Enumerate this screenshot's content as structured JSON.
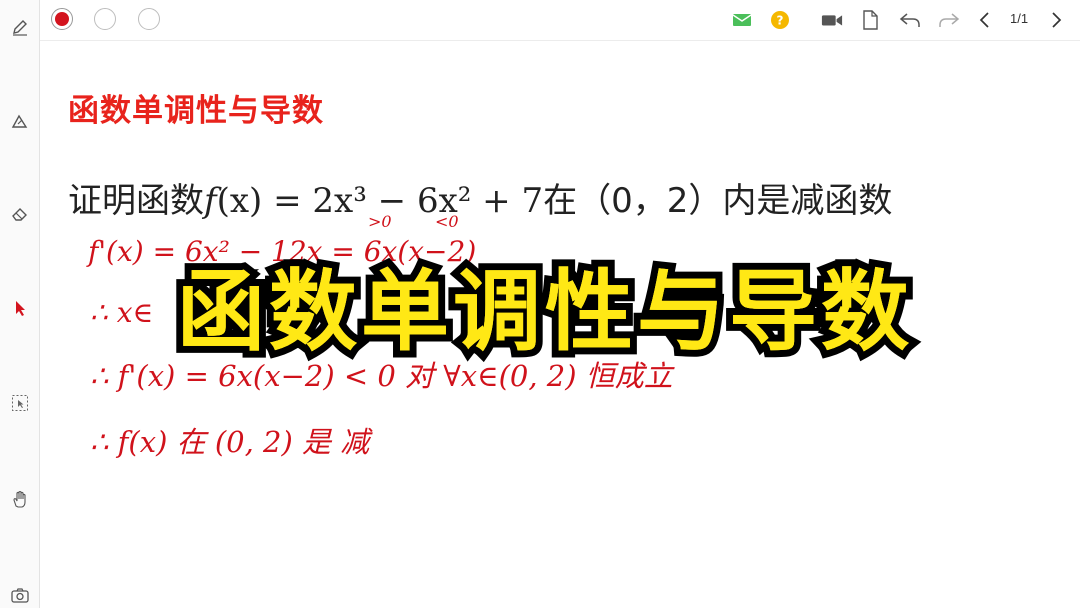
{
  "toolbar": {
    "colors": [
      "#d3141e",
      "#ffffff",
      "#ffffff"
    ],
    "page_indicator": "1/1"
  },
  "sidebar": {
    "tools": [
      "pen-icon",
      "highlighter-icon",
      "eraser-icon",
      "pointer-icon",
      "select-icon",
      "hand-icon",
      "camera-icon"
    ]
  },
  "document": {
    "title": "函数单调性与导数",
    "problem": {
      "prefix": "证明函数",
      "formula_f": "f",
      "formula_body": "(x) = 2x³ − 6x² + 7",
      "suffix": "在（0，2）内是减函数"
    },
    "handwriting": {
      "annot_gt": ">0",
      "annot_lt": "<0",
      "line1": "f'(x) = 6x² − 12x = 6x(x−2)",
      "line2": "∴ x∈",
      "line3": "∴ f'(x) = 6x(x−2) < 0  对 ∀x∈(0, 2) 恒成立",
      "line4": "∴ f(x) 在 (0, 2) 是  减"
    }
  },
  "overlay": {
    "title": "函数单调性与导数"
  }
}
